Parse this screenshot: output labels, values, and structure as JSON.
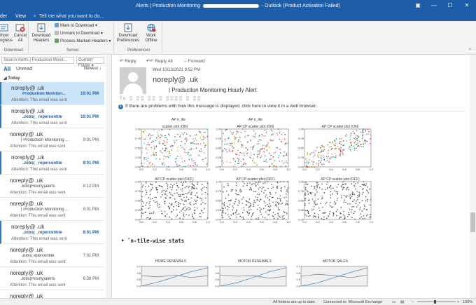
{
  "titlebar": {
    "title_prefix": "Alerts | Production Monitoring",
    "title_suffix": "- Outlook (Product Activation Failed)"
  },
  "menu": {
    "folder": "der",
    "view": "View",
    "tell": "Tell me what you want to do..."
  },
  "ribbon": {
    "show_progress": "Show Progress",
    "cancel_all": "Cancel All",
    "download_headers": "Download Headers",
    "mark_to_download": "Mark to Download",
    "unmark_to_download": "Unmark to Download",
    "process_marked_headers": "Process Marked Headers",
    "download_preferences": "Download Preferences",
    "work_offline": "Work Offline",
    "group_download": "Download",
    "group_server": "Server",
    "group_preferences": "Preferences"
  },
  "list": {
    "search_placeholder": "Search Alerts | Production Monit...",
    "current_folder": "Current Folder",
    "filter_all": "All",
    "filter_unread": "Unread",
    "sort": "Newest",
    "group_today": "Today",
    "mails": [
      {
        "from": "noreply@          .uk",
        "subject": "Production Monitori...",
        "time": "10:01 PM",
        "preview": "Attention: This email was sent"
      },
      {
        "from": "noreply@          .uk",
        "subject": ".Jobs(    _repercentile",
        "time": "10:01 PM",
        "preview": "Attention: This email was sent"
      },
      {
        "from": "noreply@          .uk",
        "subject": "| Production Monitoring ...",
        "time": "9:01 PM",
        "preview": "Attention: This email was sent"
      },
      {
        "from": "noreply@          .uk",
        "subject": ".Jobs(    _repercentile",
        "time": "9:01 PM",
        "preview": "Attention: This email was sent"
      },
      {
        "from": "noreply@          .uk",
        "subject": "Jobs(Hourly)alerts",
        "time": "8:12 PM",
        "preview": "Attention: This email was sent"
      },
      {
        "from": "noreply@          .uk",
        "subject": "| Production Monitoring ...",
        "time": "8:01 PM",
        "preview": "Attention: This email was sent"
      },
      {
        "from": "noreply@          .uk",
        "subject": ".Jobs(    _repercentile",
        "time": "8:01 PM",
        "preview": "Attention: This email was sent"
      },
      {
        "from": "noreply@          .uk",
        "subject": ".Jobs(     epercentile",
        "time": "7:01 PM",
        "preview": "Attention: This email was sent"
      },
      {
        "from": "noreply@          .uk",
        "subject": "Jobs(Hourly)alerts",
        "time": "6:38 PM",
        "preview": "Attention: This email was sent"
      },
      {
        "from": "noreply@          .uk",
        "subject": "Jobs(Hourly)alerts",
        "time": "",
        "preview": ""
      }
    ]
  },
  "reading": {
    "reply": "Reply",
    "reply_all": "Reply All",
    "forward": "Forward",
    "date": "Wed 10/13/2021 9:52 PM",
    "sender": "noreply@           .uk",
    "subject": "| Production Monitoring Hourly Alert",
    "to": "To  ▒ ▒▒  ▒▒ ▒ ▒▒▒▒ ▒ ▒▒",
    "info": "If there are problems with how this message is displayed, click here to view it in a web browser.",
    "section": "• ˆn-tile-wise stats"
  },
  "chart_data": [
    {
      "type": "scatter",
      "title": "scatter plot (ON)",
      "subtitle": "AP n_tile",
      "ylim": [
        0,
        1.0
      ],
      "xlim": [
        0,
        1.0
      ]
    },
    {
      "type": "scatter",
      "title": "AP CP scatter plot (ON)",
      "subtitle": "AP n_tile",
      "ylim": [
        0,
        1.0
      ],
      "xlim": [
        0,
        1.0
      ]
    },
    {
      "type": "scatter",
      "title": "AP CP scatter plot (ON)",
      "ylim": [
        0,
        1.0
      ],
      "xlim": [
        0,
        1.0
      ]
    },
    {
      "type": "scatter",
      "title": "AP CP scatter plot (OFF)",
      "ylim": [
        0,
        1.0
      ],
      "xlim": [
        0,
        1.0
      ]
    },
    {
      "type": "scatter",
      "title": "AP CP scatter plot (OFF)",
      "ylim": [
        0,
        1.0
      ],
      "xlim": [
        0,
        1.0
      ]
    },
    {
      "type": "scatter",
      "title": "AP CP scatter plot (OFF)",
      "ylim": [
        0,
        1.0
      ],
      "xlim": [
        0,
        1.0
      ]
    },
    {
      "type": "line",
      "title": "HOME RENEWALS",
      "ylim": [
        0.4,
        0.7
      ],
      "series": [
        {
          "name": "",
          "color": "#4a8fc4",
          "values": [
            0.4,
            0.46,
            0.54,
            0.62,
            0.68
          ]
        },
        {
          "name": "",
          "color": "#888888",
          "values": [
            0.56,
            0.54,
            0.57,
            0.53,
            0.56
          ]
        }
      ]
    },
    {
      "type": "line",
      "title": "MOTOR RENEWALS",
      "ylim": [
        0.4,
        0.7
      ],
      "series": [
        {
          "name": "",
          "color": "#4a8fc4",
          "values": [
            0.4,
            0.45,
            0.53,
            0.62,
            0.68
          ]
        },
        {
          "name": "",
          "color": "#888888",
          "values": [
            0.57,
            0.55,
            0.56,
            0.52,
            0.55
          ]
        }
      ]
    },
    {
      "type": "line",
      "title": "MOTOR SALES",
      "ylim": [
        0.4,
        0.7
      ],
      "series": [
        {
          "name": "",
          "color": "#4a8fc4",
          "values": [
            0.4,
            0.45,
            0.53,
            0.61,
            0.68
          ]
        },
        {
          "name": "",
          "color": "#888888",
          "values": [
            0.55,
            0.58,
            0.56,
            0.53,
            0.57
          ]
        }
      ]
    }
  ],
  "status": {
    "folders": "All folders are up to date.",
    "connected": "Connected to: Microsoft Exchange",
    "zoom": "100%"
  }
}
